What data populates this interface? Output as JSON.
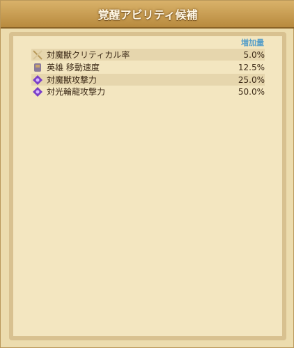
{
  "title": "覚醒アビリティ候補",
  "table": {
    "column_header": "増加量",
    "rows": [
      {
        "icon": "crossed-swords-icon",
        "label": "対魔獣クリティカル率",
        "value": "5.0%"
      },
      {
        "icon": "hero-boot-icon",
        "label": "英雄 移動速度",
        "value": "12.5%"
      },
      {
        "icon": "purple-gem-icon",
        "label": "対魔獣攻撃力",
        "value": "25.0%"
      },
      {
        "icon": "purple-gem-icon",
        "label": "対光輪龍攻撃力",
        "value": "50.0%"
      }
    ]
  }
}
